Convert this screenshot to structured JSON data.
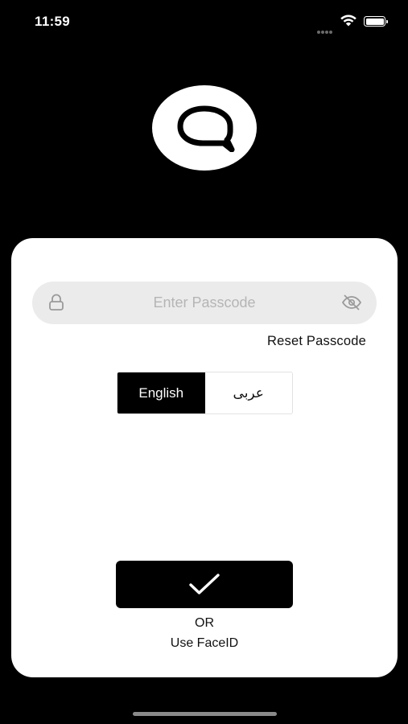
{
  "status_bar": {
    "time": "11:59",
    "wifi_icon": "wifi-icon",
    "battery_icon": "battery-icon",
    "battery_level": 1.0
  },
  "logo": {
    "icon": "q-logo-icon"
  },
  "login": {
    "passcode_placeholder": "Enter Passcode",
    "passcode_value": "",
    "lock_icon": "lock-icon",
    "visibility_icon": "eye-off-icon",
    "reset_label": "Reset Passcode"
  },
  "language": {
    "options": [
      "English",
      "عربى"
    ],
    "selected": "English"
  },
  "actions": {
    "submit_icon": "checkmark-icon",
    "or_label": "OR",
    "faceid_label": "Use FaceID"
  },
  "colors": {
    "background": "#000000",
    "card": "#ffffff",
    "field": "#ebebeb",
    "accent": "#000000"
  }
}
